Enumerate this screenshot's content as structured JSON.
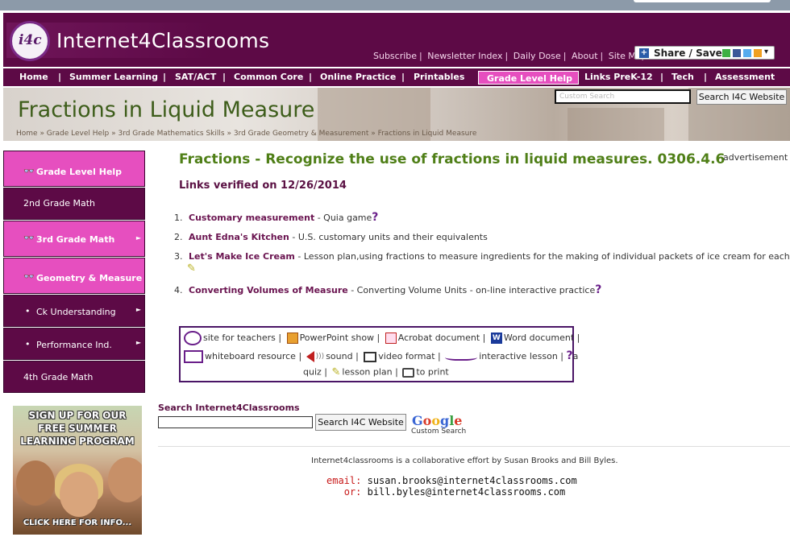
{
  "logo": {
    "badge": "i4c",
    "name": "Internet4Classrooms"
  },
  "top_links": [
    "Subscribe",
    "Newsletter Index",
    "Daily Dose",
    "About",
    "Site Map"
  ],
  "share_label": "Share / Save",
  "nav": [
    "Home",
    "Summer Learning",
    "SAT/ACT",
    "Common Core",
    "Online Practice",
    "Printables",
    "Grade Level Help",
    "Links PreK-12",
    "Tech",
    "Assessment"
  ],
  "header": {
    "title": "Fractions in Liquid Measure",
    "breadcrumb": "Home » Grade Level Help » 3rd Grade Mathematics Skills » 3rd Grade Geometry & Measurement » Fractions in Liquid Measure",
    "search_placeholder": "Custom Search",
    "search_button": "Search I4C Website"
  },
  "sidebar": [
    {
      "label": "Grade Level Help",
      "style": "pink",
      "arrow": false,
      "icon": true
    },
    {
      "label": "2nd Grade Math",
      "style": "dark",
      "arrow": false,
      "icon": false
    },
    {
      "label": "3rd Grade Math",
      "style": "pink",
      "arrow": true,
      "icon": true
    },
    {
      "label": "Geometry & Measure",
      "style": "pink",
      "arrow": false,
      "icon": true
    },
    {
      "label": "Ck Understanding",
      "style": "dark",
      "arrow": true,
      "icon": false
    },
    {
      "label": "Performance Ind.",
      "style": "dark",
      "arrow": true,
      "icon": false
    },
    {
      "label": "4th Grade Math",
      "style": "dark",
      "arrow": false,
      "icon": false
    }
  ],
  "promo": {
    "line1": "SIGN UP FOR OUR",
    "line2": "FREE SUMMER",
    "line3": "LEARNING PROGRAM",
    "cta": "CLICK HERE FOR INFO..."
  },
  "main": {
    "heading": "Fractions - Recognize the use of fractions in liquid measures. 0306.4.6",
    "advertisement": "advertisement",
    "verified": "Links verified on 12/26/2014",
    "items": [
      {
        "num": "1.",
        "link": "Customary measurement",
        "desc": " - Quia game"
      },
      {
        "num": "2.",
        "link": "Aunt Edna's Kitchen",
        "desc": "  - U.S. customary units and their equivalents"
      },
      {
        "num": "3.",
        "link": "Let's Make Ice Cream",
        "desc": " - Lesson plan,using fractions to measure ingredients for the making of individual packets of ice cream for each student"
      },
      {
        "num": "4.",
        "link": "Converting Volumes of Measure",
        "desc": "  - Converting Volume Units - on-line interactive practice"
      }
    ]
  },
  "legend": {
    "site_for_teachers": "site for teachers |",
    "powerpoint": "PowerPoint show |",
    "acrobat": "Acrobat document |",
    "word": "Word document |",
    "whiteboard": "whiteboard resource |",
    "sound": "sound |",
    "video": "video format |",
    "interactive": "interactive lesson |",
    "a": "a",
    "quiz": "quiz |",
    "lesson_plan": "lesson plan |",
    "to_print": "to print"
  },
  "search2": {
    "label": "Search Internet4Classrooms",
    "button": "Search I4C Website",
    "google_sub": "Custom Search"
  },
  "footer": {
    "collab": "Internet4classrooms is a collaborative effort by Susan Brooks and Bill Byles.",
    "email_label": "email:",
    "email1": "susan.brooks@internet4classrooms.com",
    "or_label": "or:",
    "email2": "bill.byles@internet4classrooms.com"
  }
}
